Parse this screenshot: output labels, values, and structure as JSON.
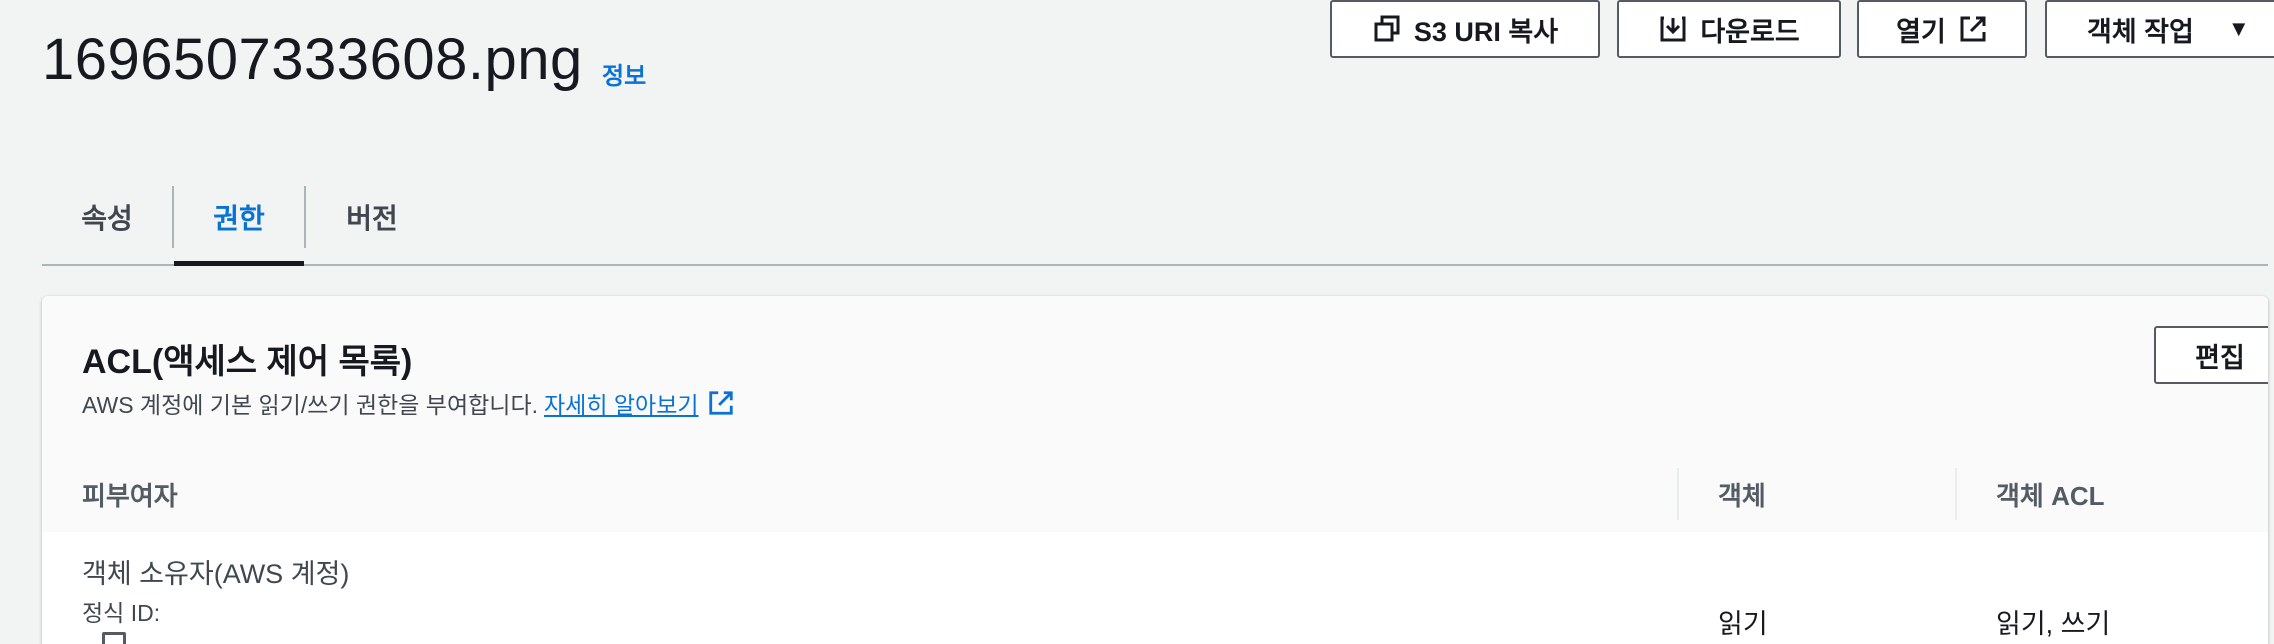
{
  "header": {
    "object_name": "1696507333608.png",
    "info_link": "정보",
    "buttons": {
      "copy_s3_uri": "S3 URI 복사",
      "download": "다운로드",
      "open": "열기",
      "object_actions": "객체 작업"
    }
  },
  "tabs": [
    {
      "label": "속성",
      "selected": false
    },
    {
      "label": "권한",
      "selected": true
    },
    {
      "label": "버전",
      "selected": false
    }
  ],
  "acl_panel": {
    "title": "ACL(액세스 제어 목록)",
    "description": "AWS 계정에 기본 읽기/쓰기 권한을 부여합니다.",
    "learn_more": "자세히 알아보기",
    "edit_button": "편집",
    "columns": {
      "grantee": "피부여자",
      "objects": "객체",
      "object_acl": "객체 ACL"
    },
    "rows": [
      {
        "grantee": "객체 소유자(AWS 계정)",
        "canonical_id_label": "정식 ID:",
        "objects": "읽기",
        "object_acl": "읽기, 쓰기"
      }
    ]
  },
  "colors": {
    "accent": "#0972d3",
    "background": "#f2f3f3",
    "text": "#16191f"
  },
  "icons": {
    "copy": "copy-icon",
    "download": "download-icon",
    "open": "external-link-icon",
    "actions": "caret-down-icon",
    "learn_more": "external-link-icon"
  }
}
